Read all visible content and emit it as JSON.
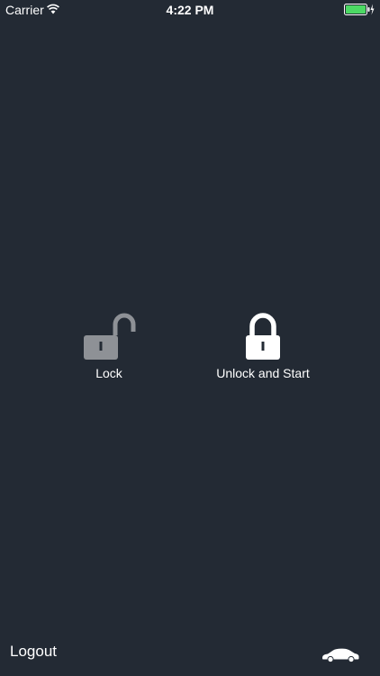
{
  "status_bar": {
    "carrier": "Carrier",
    "time": "4:22 PM",
    "wifi_icon": "wifi-icon",
    "battery_icon": "battery-charging-icon",
    "battery_color": "#4cd964"
  },
  "controls": {
    "lock": {
      "label": "Lock",
      "icon": "unlocked-padlock-icon",
      "icon_color": "#8e9196"
    },
    "unlock_start": {
      "label": "Unlock and Start",
      "icon": "locked-padlock-icon",
      "icon_color": "#ffffff"
    }
  },
  "footer": {
    "logout_label": "Logout",
    "car_icon": "car-icon"
  },
  "colors": {
    "background": "#232a34",
    "text": "#ffffff"
  }
}
